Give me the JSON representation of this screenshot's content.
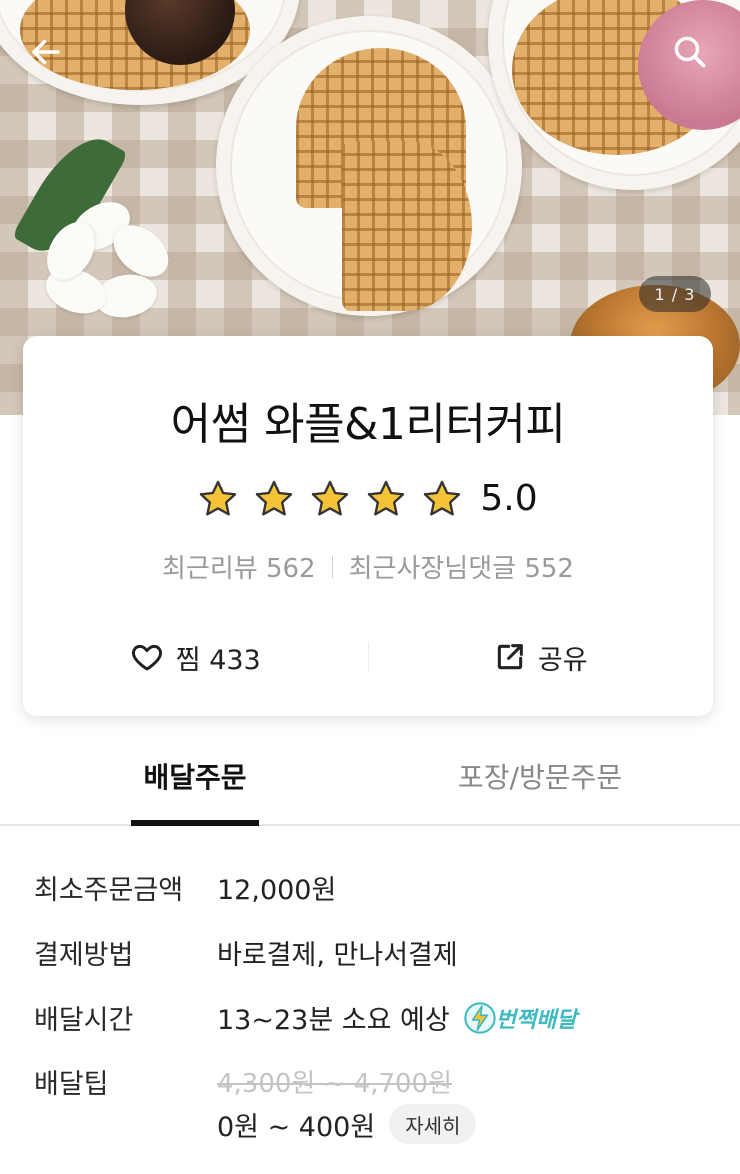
{
  "hero": {
    "pager": "1 / 3",
    "back_icon": "arrow-left-icon",
    "search_icon": "search-icon"
  },
  "store": {
    "name": "어썸 와플&1리터커피",
    "rating": 5.0,
    "rating_text": "5.0",
    "star_count": 5,
    "star_color": "#f5c338",
    "recent_reviews_label": "최근리뷰 562",
    "recent_owner_replies_label": "최근사장님댓글 552",
    "favorite_label": "찜 433",
    "favorite_icon": "heart-icon",
    "share_label": "공유",
    "share_icon": "share-icon"
  },
  "tabs": [
    {
      "label": "배달주문",
      "active": true
    },
    {
      "label": "포장/방문주문",
      "active": false
    }
  ],
  "info": {
    "min_order": {
      "label": "최소주문금액",
      "value": "12,000원"
    },
    "payment": {
      "label": "결제방법",
      "value": "바로결제, 만나서결제"
    },
    "delivery_time": {
      "label": "배달시간",
      "value": "13~23분 소요 예상",
      "badge": "번쩍배달",
      "badge_icon": "lightning-icon",
      "badge_color": "#3fb9c1"
    },
    "delivery_tip": {
      "label": "배달팁",
      "original": "4,300원 ~ 4,700원",
      "value": "0원 ~ 400원",
      "detail_button": "자세히"
    }
  }
}
